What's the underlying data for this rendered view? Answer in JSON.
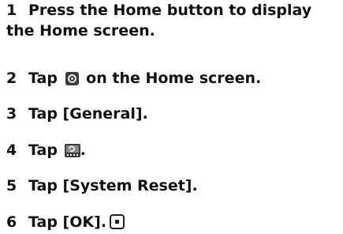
{
  "steps": [
    {
      "number": "1",
      "text": "Press the Home button to display the Home screen."
    },
    {
      "number": "2",
      "before": "Tap",
      "after": "on the Home screen.",
      "icon": "settings-icon"
    },
    {
      "number": "3",
      "text": "Tap [General]."
    },
    {
      "number": "4",
      "before": "Tap",
      "after": ".",
      "icon": "system-reset-icon"
    },
    {
      "number": "5",
      "text": "Tap [System Reset]."
    },
    {
      "number": "6",
      "text": "Tap [OK].",
      "icon": "end-mark-icon"
    }
  ]
}
